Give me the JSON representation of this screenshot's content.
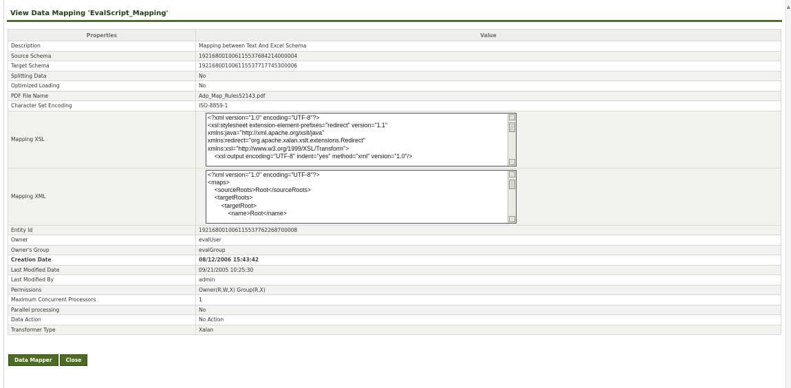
{
  "page": {
    "title": "View Data Mapping 'EvalScript_Mapping'"
  },
  "table": {
    "headers": [
      "Properties",
      "Value"
    ],
    "rows": [
      {
        "label": "Description",
        "value": "Mapping between Text And Excel Schema"
      },
      {
        "label": "Source Schema",
        "value": "192168001006115537684214000004"
      },
      {
        "label": "Target Schema",
        "value": "192168001006115537717745300006"
      },
      {
        "label": "Splitting Data",
        "value": "No"
      },
      {
        "label": "Optimized Loading",
        "value": "No"
      },
      {
        "label": "PDF File Name",
        "value": "Adp_Map_Rules52143.pdf"
      },
      {
        "label": "Character Set Encoding",
        "value": "ISO-8859-1"
      },
      {
        "label": "Mapping XSL",
        "code": [
          "<?xml version=\"1.0\" encoding=\"UTF-8\"?>",
          "<xsl:stylesheet extension-element-prefixes=\"redirect\" version=\"1.1\"",
          "xmlns:java=\"http://xml.apache.org/xslt/java\"",
          "xmlns:redirect=\"org.apache.xalan.xslt.extensions.Redirect\"",
          "xmlns:xsl=\"http://www.w3.org/1999/XSL/Transform\">",
          "    <xsl:output encoding=\"UTF-8\" indent=\"yes\" method=\"xml\" version=\"1.0\"/>"
        ]
      },
      {
        "label": "Mapping XML",
        "code": [
          "<?xml version=\"1.0\" encoding=\"UTF-8\"?>",
          "<maps>",
          "    <sourceRoots>Root</sourceRoots>",
          "    <targetRoots>",
          "        <targetRoot>",
          "            <name>Root</name>"
        ]
      },
      {
        "label": "Entity Id",
        "value": "192168001006115537762268700008"
      },
      {
        "label": "Owner",
        "value": "evalUser"
      },
      {
        "label": "Owner's Group",
        "value": "evalGroup"
      },
      {
        "label": "Creation Date",
        "value": "08/12/2006 15:43:42",
        "bold": true
      },
      {
        "label": "Last Modified Date",
        "value": "09/21/2005 10:25:30"
      },
      {
        "label": "Last Modified By",
        "value": "admin"
      },
      {
        "label": "Permissions",
        "value": "Owner(R,W,X) Group(R,X)"
      },
      {
        "label": "Maximum Concurrent Processors",
        "value": "1"
      },
      {
        "label": "Parallel processing",
        "value": "No"
      },
      {
        "label": "Data Action",
        "value": "No Action"
      },
      {
        "label": "Transformer Type",
        "value": "Xalan"
      }
    ]
  },
  "buttons": {
    "data_mapper": "Data Mapper",
    "close": "Close"
  }
}
